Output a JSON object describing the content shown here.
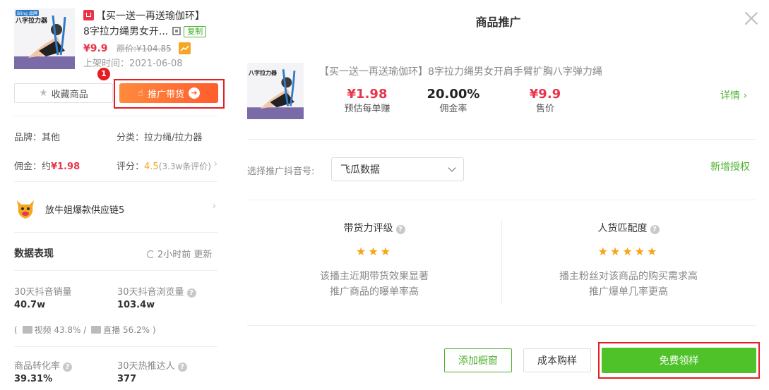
{
  "product": {
    "title_line1": "【买一送一再送瑜伽环】",
    "title_line2": "8字拉力绳男女开...",
    "copy_label": "复制",
    "price": "¥9.9",
    "original_price": "原价:¥104.85",
    "listed_date": "上架时间：2021-06-08",
    "thumb_text": "八字拉力器",
    "thumb_tag": "Bling 品牌"
  },
  "actions": {
    "favorite_label": "收藏商品",
    "promote_label": "推广带货",
    "step_number": "1"
  },
  "info": {
    "brand": "品牌：其他",
    "category": "分类：拉力绳/拉力器",
    "commission_label": "佣金：约",
    "commission_value": "¥1.98",
    "rating_label": "评分：",
    "rating_value": "4.5",
    "rating_count": "(3.3w条评价)"
  },
  "shop": {
    "name": "放牛姐爆款供应链5"
  },
  "data_section": {
    "title": "数据表现",
    "refresh_text": "2小时前 更新",
    "stats": [
      {
        "label": "30天抖音销量",
        "value": "40.7w"
      },
      {
        "label": "30天抖音浏览量",
        "value": "103.4w"
      },
      {
        "label": "商品转化率",
        "value": "39.31%"
      },
      {
        "label": "30天热推达人",
        "value": "377"
      }
    ],
    "split_open": "(",
    "split_video": "视频 43.8% /",
    "split_live": "直播 56.2%",
    "split_close": ")"
  },
  "modal": {
    "title": "商品推广",
    "card_title": "【买一送一再送瑜伽环】8字拉力绳男女开肩手臂扩胸八字弹力绳",
    "metrics": [
      {
        "value": "¥1.98",
        "label": "预估每单赚"
      },
      {
        "value": "20.00%",
        "label": "佣金率"
      },
      {
        "value": "¥9.9",
        "label": "售价"
      }
    ],
    "detail_link": "详情",
    "account_label": "选择推广抖音号:",
    "account_value": "飞瓜数据",
    "add_auth": "新增授权",
    "col1_title": "带货力评级",
    "col1_stars": "★★★",
    "col1_desc1": "该播主近期带货效果显著",
    "col1_desc2": "推广商品的曝单率高",
    "col2_title": "人货匹配度",
    "col2_stars": "★★★★★",
    "col2_desc1": "播主粉丝对该商品的购买需求高",
    "col2_desc2": "推广爆单几率更高",
    "btn_window": "添加橱窗",
    "btn_buy": "成本购样",
    "btn_sample": "免费领样"
  },
  "colors": {
    "accent_green": "#4fc22a",
    "price_red": "#e8354a",
    "highlight_red": "#e41e22"
  }
}
